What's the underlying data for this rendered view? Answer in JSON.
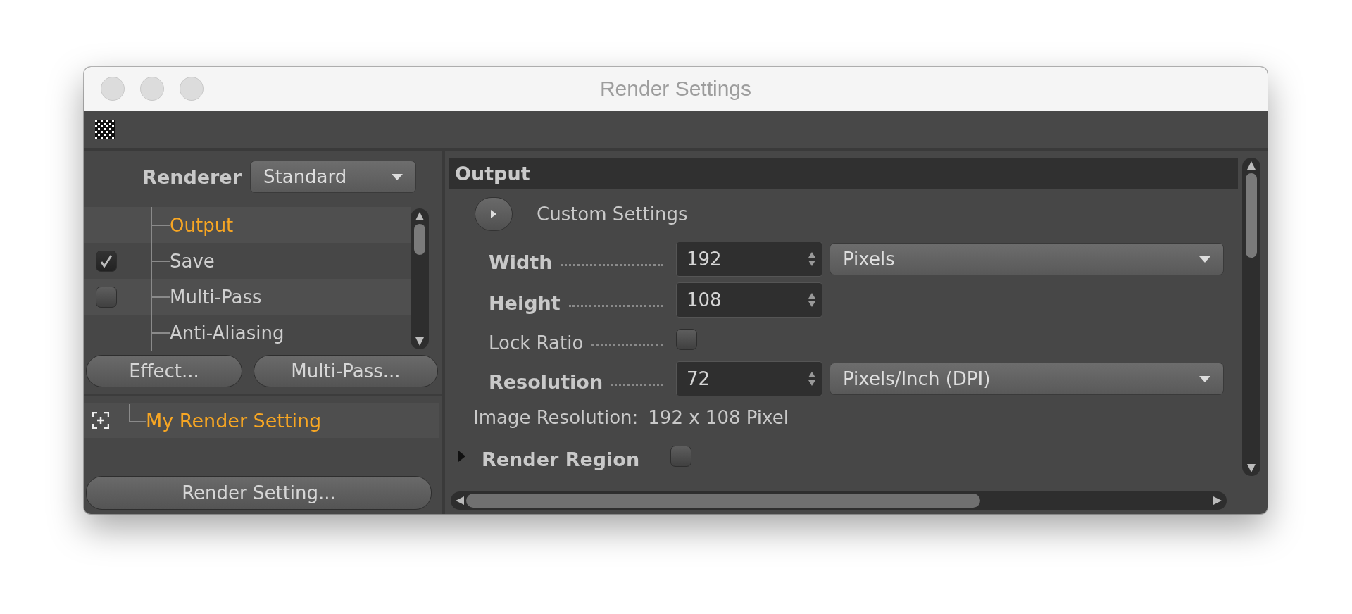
{
  "window": {
    "title": "Render Settings"
  },
  "renderer": {
    "label": "Renderer",
    "value": "Standard"
  },
  "tree": [
    {
      "label": "Output",
      "kind": "plain",
      "selected": true
    },
    {
      "label": "Save",
      "kind": "toggle",
      "checked": true,
      "selected": false
    },
    {
      "label": "Multi-Pass",
      "kind": "toggle",
      "checked": false,
      "selected": false
    },
    {
      "label": "Anti-Aliasing",
      "kind": "plain",
      "selected": false
    }
  ],
  "buttons": [
    "Effect...",
    "Multi-Pass..."
  ],
  "settings_list": [
    {
      "label": "My Render Setting",
      "selected": true
    }
  ],
  "settings_button": "Render Setting...",
  "section": {
    "title": "Output",
    "custom_label": "Custom Settings"
  },
  "fields": [
    {
      "kind": "number",
      "label": "Width",
      "bold": true,
      "value": "192",
      "unit": "Pixels"
    },
    {
      "kind": "number",
      "label": "Height",
      "bold": true,
      "value": "108"
    },
    {
      "kind": "checkbox",
      "label": "Lock Ratio",
      "bold": false,
      "checked": false
    },
    {
      "kind": "number",
      "label": "Resolution",
      "bold": true,
      "value": "72",
      "unit": "Pixels/Inch (DPI)"
    }
  ],
  "image_resolution": {
    "label": "Image Resolution:",
    "value": "192 x 108 Pixel"
  },
  "render_region": {
    "label": "Render Region",
    "expanded": false,
    "checked": false
  }
}
